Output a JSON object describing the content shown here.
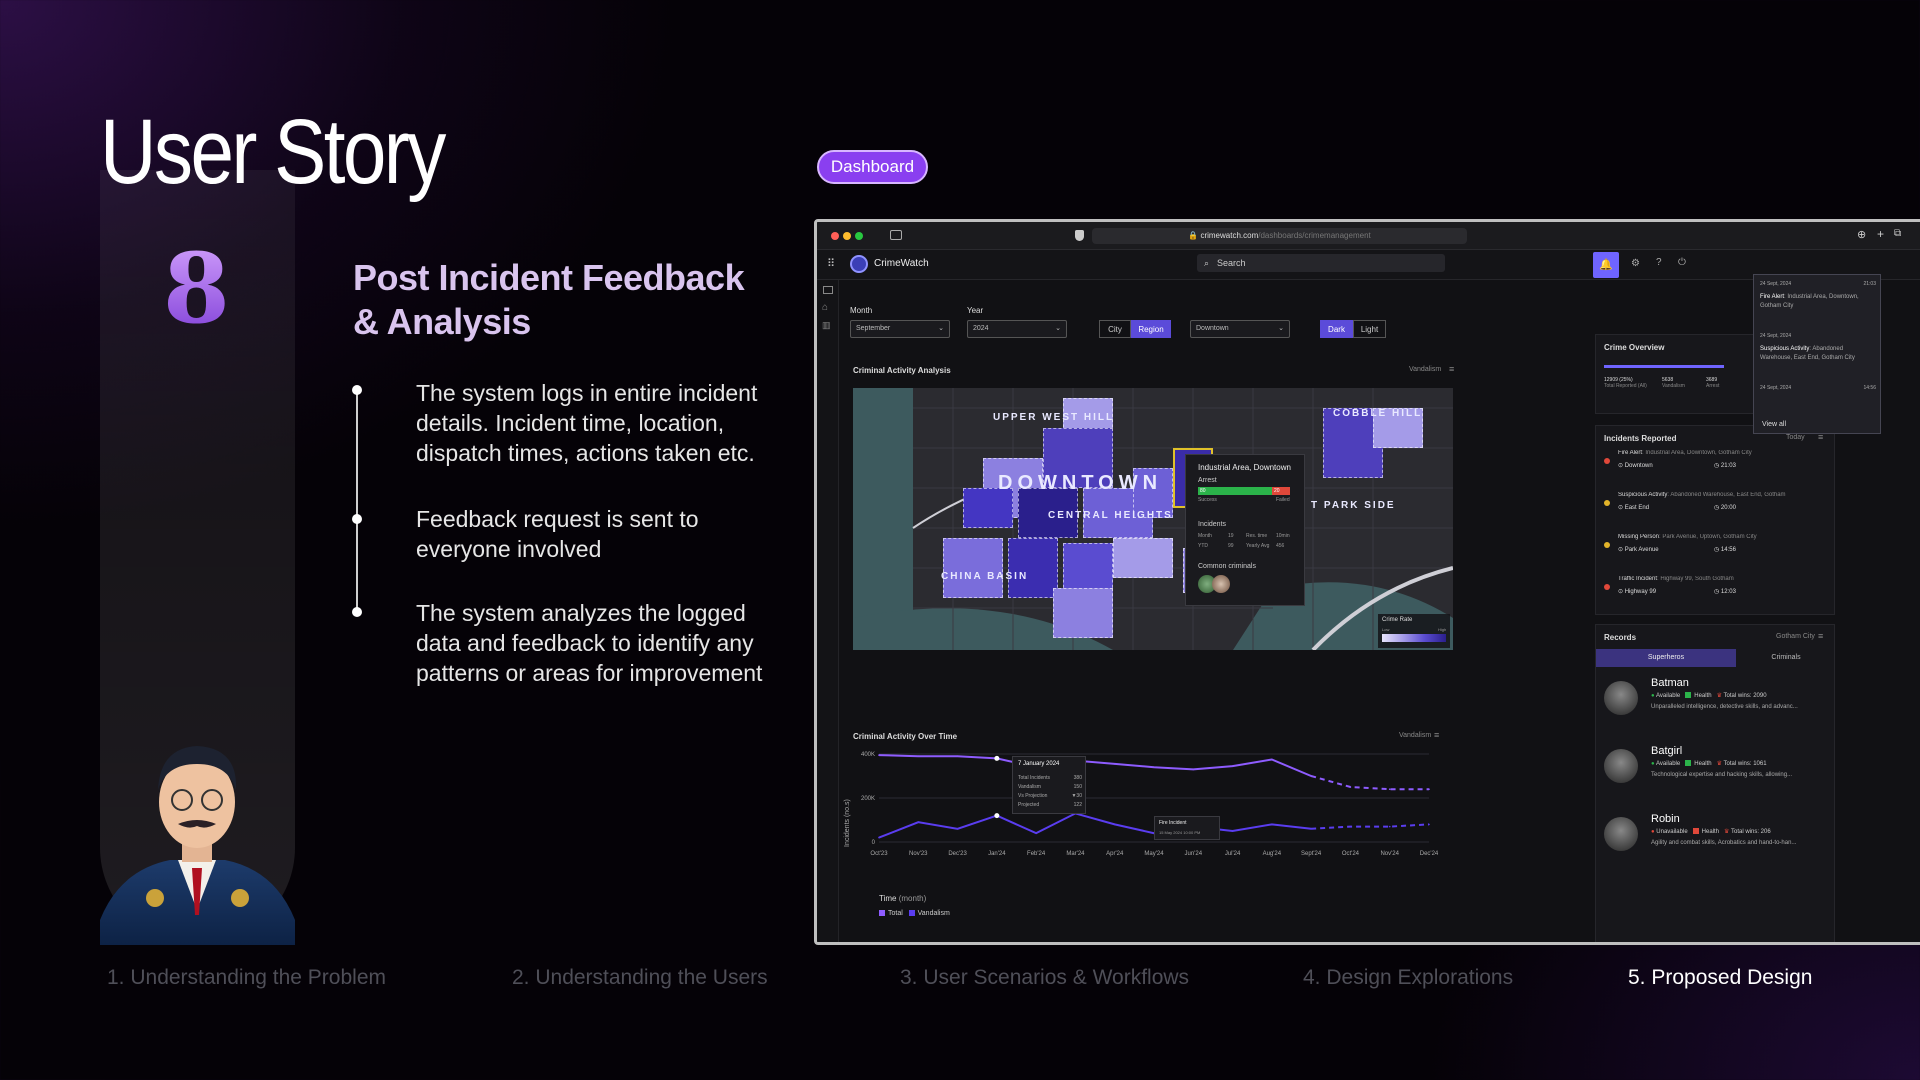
{
  "slide": {
    "title": "User Story",
    "story_number": "8",
    "story_title_line1": "Post Incident Feedback",
    "story_title_line2": "& Analysis",
    "bullets": [
      "The system logs in entire incident details. Incident time, location, dispatch times, actions taken etc.",
      "Feedback request is sent to everyone involved",
      "The system analyzes the logged data and feedback to identify any patterns or areas for improvement"
    ],
    "badge": "Dashboard",
    "steps": [
      "1.  Understanding the Problem",
      "2.  Understanding the Users",
      "3.  User Scenarios & Workflows",
      "4.  Design Explorations",
      "5.  Proposed Design"
    ]
  },
  "browser": {
    "url_host": "crimewatch.com",
    "url_path": "/dashboards/crimemanagement"
  },
  "app": {
    "name": "CrimeWatch",
    "search_placeholder": "Search",
    "filters": {
      "month_label": "Month",
      "month_value": "September",
      "year_label": "Year",
      "year_value": "2024",
      "scope_options": [
        "City",
        "Region"
      ],
      "scope_selected": "Region",
      "region_value": "Downtown",
      "theme_options": [
        "Dark",
        "Light"
      ],
      "theme_selected": "Dark"
    },
    "notifications": {
      "items": [
        {
          "date": "24 Sept, 2024",
          "time": "21:03",
          "title": "Fire Alert",
          "text": ": Industrial Area, Downtown, Gotham City"
        },
        {
          "date": "24 Sept, 2024",
          "time": "",
          "title": "Suspicious Activity",
          "text": ": Abandoned Warehouse, East End, Gotham City"
        },
        {
          "date": "24 Sept, 2024",
          "time": "14:56",
          "title": "",
          "text": ""
        }
      ],
      "view_all": "View all"
    },
    "criminal_activity": {
      "title": "Criminal Activity Analysis",
      "filter": "Vandalism",
      "map_labels": [
        "UPPER WEST HILL",
        "DOWNTOWN",
        "CENTRAL HEIGHTS",
        "CHINA BASIN",
        "T PARK SIDE",
        "COBBLE HILL"
      ],
      "popup": {
        "title": "Industrial Area, Downtown",
        "arrest_label": "Arrest",
        "arrest_success": "80",
        "arrest_failed": "20",
        "success_label": "Success",
        "failed_label": "Failed",
        "incidents_label": "Incidents",
        "month_label": "Month",
        "month_value": "19",
        "res_time_label": "Res. time",
        "res_time_value": "10min",
        "ytd_label": "YTD",
        "ytd_value": "99",
        "yearly_avg_label": "Yearly Avg",
        "yearly_avg_value": "456",
        "common_criminals_label": "Common criminals"
      },
      "legend_title": "Crime Rate",
      "legend_low": "Low",
      "legend_high": "High"
    },
    "activity_over_time": {
      "title": "Criminal Activity Over Time",
      "filter": "Vandalism",
      "y_label": "Incidents (no.s)",
      "x_title": "Time",
      "x_unit": "(month)",
      "legend": [
        "Total",
        "Vandalism"
      ],
      "tooltip": {
        "date": "7 January 2024",
        "rows": [
          {
            "label": "Total Incidents",
            "value": "380"
          },
          {
            "label": "Vandalism",
            "value": "150"
          },
          {
            "label": "Vs Projection",
            "value": "▼30"
          },
          {
            "label": "Projected",
            "value": "122"
          }
        ]
      },
      "fire_tooltip": {
        "title": "Fire Incident",
        "date": "15 May 2024  10:00 PM"
      }
    },
    "crime_overview": {
      "title": "Crime Overview",
      "stats": [
        {
          "value": "12909 (25%)",
          "label": "Total Reported (All)",
          "sub": "Current Month"
        },
        {
          "value": "5638",
          "label": "Vandalism",
          "sub": "Current Month"
        },
        {
          "value": "3689",
          "label": "Arrest",
          "sub": "Current Month"
        }
      ]
    },
    "incidents": {
      "title": "Incidents Reported",
      "filter": "Today",
      "items": [
        {
          "type": "Fire Alert",
          "place": ": Industrial Area, Downtown, Gotham City",
          "area": "Downtown",
          "time": "21:03"
        },
        {
          "type": "Suspicious Activity",
          "place": ": Abandoned Warehouse, East End, Gotham",
          "area": "East End",
          "time": "20:00"
        },
        {
          "type": "Missing Person",
          "place": ": Park Avenue, Uptown, Gotham City",
          "area": "Park Avenue",
          "time": "14:56"
        },
        {
          "type": "Traffic Incident",
          "place": ": Highway 99, South Gotham",
          "area": "Highway 99",
          "time": "12:03"
        }
      ]
    },
    "records": {
      "title": "Records",
      "filter": "Gotham City",
      "tabs": [
        "Superheros",
        "Criminals"
      ],
      "heroes": [
        {
          "name": "Batman",
          "status": "Available",
          "health": "Health",
          "wins": "Total wins: 2090",
          "desc": "Unparalleled intelligence, detective skills, and advanc...",
          "health_color": "#2bb34a"
        },
        {
          "name": "Batgirl",
          "status": "Available",
          "health": "Health",
          "wins": "Total wins: 1061",
          "desc": "Technological expertise and hacking skills, allowing...",
          "health_color": "#2bb34a"
        },
        {
          "name": "Robin",
          "status": "Unavailable",
          "health": "Health",
          "wins": "Total wins: 206",
          "desc": "Agility and combat skills, Acrobatics and hand-to-han...",
          "health_color": "#e0483a"
        }
      ]
    }
  },
  "chart_data": {
    "type": "line",
    "x": [
      "Oct'23",
      "Nov'23",
      "Dec'23",
      "Jan'24",
      "Feb'24",
      "Mar'24",
      "Apr'24",
      "May'24",
      "Jun'24",
      "Jul'24",
      "Aug'24",
      "Sept'24",
      "Oct'24",
      "Nov'24",
      "Dec'24"
    ],
    "y_ticks": [
      "0",
      "200K",
      "400K"
    ],
    "ylim": [
      0,
      400000
    ],
    "series": [
      {
        "name": "Total",
        "color": "#8e5cff",
        "values": [
          395000,
          390000,
          390000,
          380000,
          340000,
          370000,
          355000,
          340000,
          330000,
          345000,
          375000,
          300000,
          250000,
          240000,
          240000
        ],
        "projected_from_index": 11
      },
      {
        "name": "Vandalism",
        "color": "#5a3df0",
        "values": [
          20000,
          90000,
          60000,
          120000,
          40000,
          130000,
          80000,
          40000,
          70000,
          50000,
          80000,
          60000,
          70000,
          70000,
          80000
        ],
        "projected_from_index": 11
      }
    ]
  },
  "colors": {
    "accent": "#8a3ff0",
    "primary_blue": "#5b4bd9",
    "success": "#2bb34a",
    "danger": "#e0483a"
  }
}
